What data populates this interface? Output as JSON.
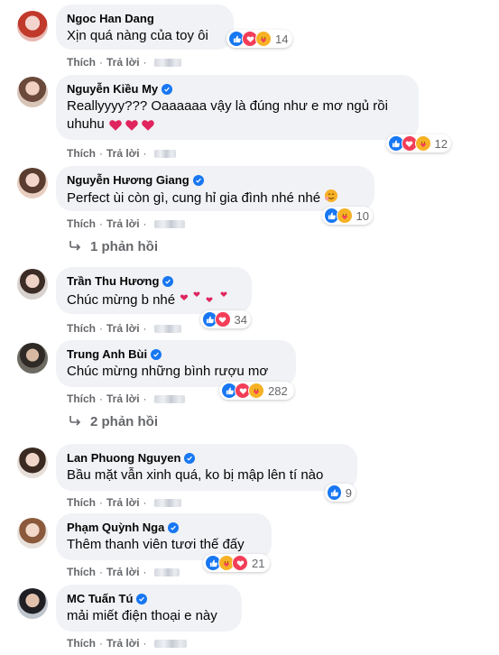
{
  "actions": {
    "like": "Thích",
    "reply": "Trả lời",
    "sep": "·"
  },
  "comments": [
    {
      "name": "Ngoc Han Dang",
      "verified": false,
      "text": "Xịn quá nàng của toy ôi",
      "reactions": [
        "like",
        "love",
        "care"
      ],
      "count": "14"
    },
    {
      "name": "Nguyễn Kiều My",
      "verified": true,
      "text": "Reallyyyy??? Oaaaaaa vậy là đúng như e mơ ngủ rồi uhuhu",
      "reactions": [
        "like",
        "love",
        "care"
      ],
      "count": "12"
    },
    {
      "name": "Nguyễn Hương Giang",
      "verified": true,
      "text": "Perfect ùi còn gì, cung hỉ gia đình nhé nhé",
      "reactions": [
        "like",
        "care"
      ],
      "count": "10",
      "replies": "1 phản hồi"
    },
    {
      "name": "Trần Thu Hương",
      "verified": true,
      "text": "Chúc mừng b nhé",
      "reactions": [
        "like",
        "love"
      ],
      "count": "34"
    },
    {
      "name": "Trung Anh Bùi",
      "verified": true,
      "text": "Chúc mừng những bình rượu mơ",
      "reactions": [
        "like",
        "love",
        "care"
      ],
      "count": "282",
      "replies": "2 phản hồi"
    },
    {
      "name": "Lan Phuong Nguyen",
      "verified": true,
      "text": "Bầu mặt vẫn xinh quá, ko bị mập lên tí nào",
      "reactions": [
        "like"
      ],
      "count": "9"
    },
    {
      "name": "Phạm Quỳnh Nga",
      "verified": true,
      "text": "Thêm thanh viên tươi thế đấy",
      "reactions": [
        "like",
        "care",
        "love"
      ],
      "count": "21"
    },
    {
      "name": "MC Tuấn Tú",
      "verified": true,
      "text": "mải miết điện thoại e này"
    }
  ],
  "colors": {
    "accent": "#1877f2",
    "love": "#f33e58",
    "care": "#f7b125",
    "bubble": "#f0f2f5",
    "muted": "#65676b"
  }
}
